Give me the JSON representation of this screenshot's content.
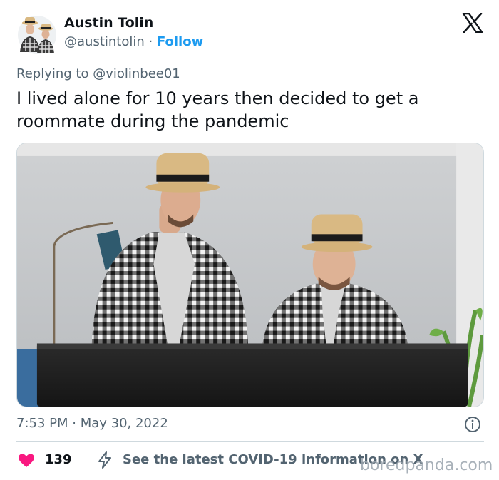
{
  "tweet": {
    "author_name": "Austin Tolin",
    "handle": "@austintolin",
    "separator": " · ",
    "follow_label": "Follow",
    "reply_label": "Replying to @violinbee01",
    "text": "I lived alone for 10 years then decided to get a roommate during the pandemic",
    "timestamp": "7:53 PM · May 30, 2022",
    "like_count": "139",
    "covid_label": "See the latest COVID-19 information on X"
  },
  "watermark": "boredpanda.com",
  "colors": {
    "accent_blue": "#1d9bf0",
    "heart_pink": "#f91880",
    "muted_text": "#536471",
    "primary_text": "#0f1419",
    "divider": "#cfd9de"
  },
  "icons": {
    "logo": "x-logo-icon",
    "info": "info-icon",
    "like": "heart-icon",
    "covid": "lightning-icon"
  }
}
